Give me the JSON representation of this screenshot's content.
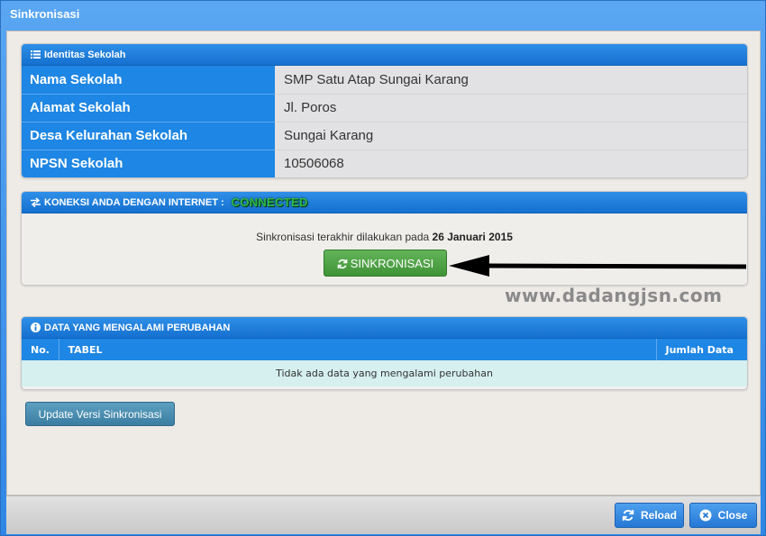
{
  "window": {
    "title": "Sinkronisasi"
  },
  "identity": {
    "header": "Identitas Sekolah",
    "rows": [
      {
        "label": "Nama Sekolah",
        "value": "SMP Satu Atap Sungai Karang"
      },
      {
        "label": "Alamat Sekolah",
        "value": "Jl. Poros"
      },
      {
        "label": "Desa Kelurahan Sekolah",
        "value": "Sungai Karang"
      },
      {
        "label": "NPSN Sekolah",
        "value": "10506068"
      }
    ]
  },
  "connection": {
    "header": "KONEKSI ANDA DENGAN INTERNET :",
    "status": "CONNECTED",
    "status_color": "#2fb84a",
    "last_sync_prefix": "Sinkronisasi terakhir dilakukan pada",
    "last_sync_date": "26 Januari 2015",
    "sync_button": "SINKRONISASI"
  },
  "watermark": "www.dadangjsn.com",
  "changes": {
    "header": "DATA YANG MENGALAMI PERUBAHAN",
    "columns": [
      "No.",
      "TABEL",
      "Jumlah Data"
    ],
    "empty_message": "Tidak ada data yang mengalami perubahan"
  },
  "update_button": "Update Versi Sinkronisasi",
  "footer": {
    "reload_label": "Reload",
    "close_label": "Close"
  },
  "icons": {
    "identity": "list-icon",
    "connection": "exchange-icon",
    "sync": "refresh-icon",
    "changes": "info-icon",
    "reload": "refresh-icon",
    "close": "close-circle-icon"
  },
  "colors": {
    "accent": "#1e86e4",
    "sync_button": "#4ea444",
    "update_button": "#4a8eb2"
  }
}
